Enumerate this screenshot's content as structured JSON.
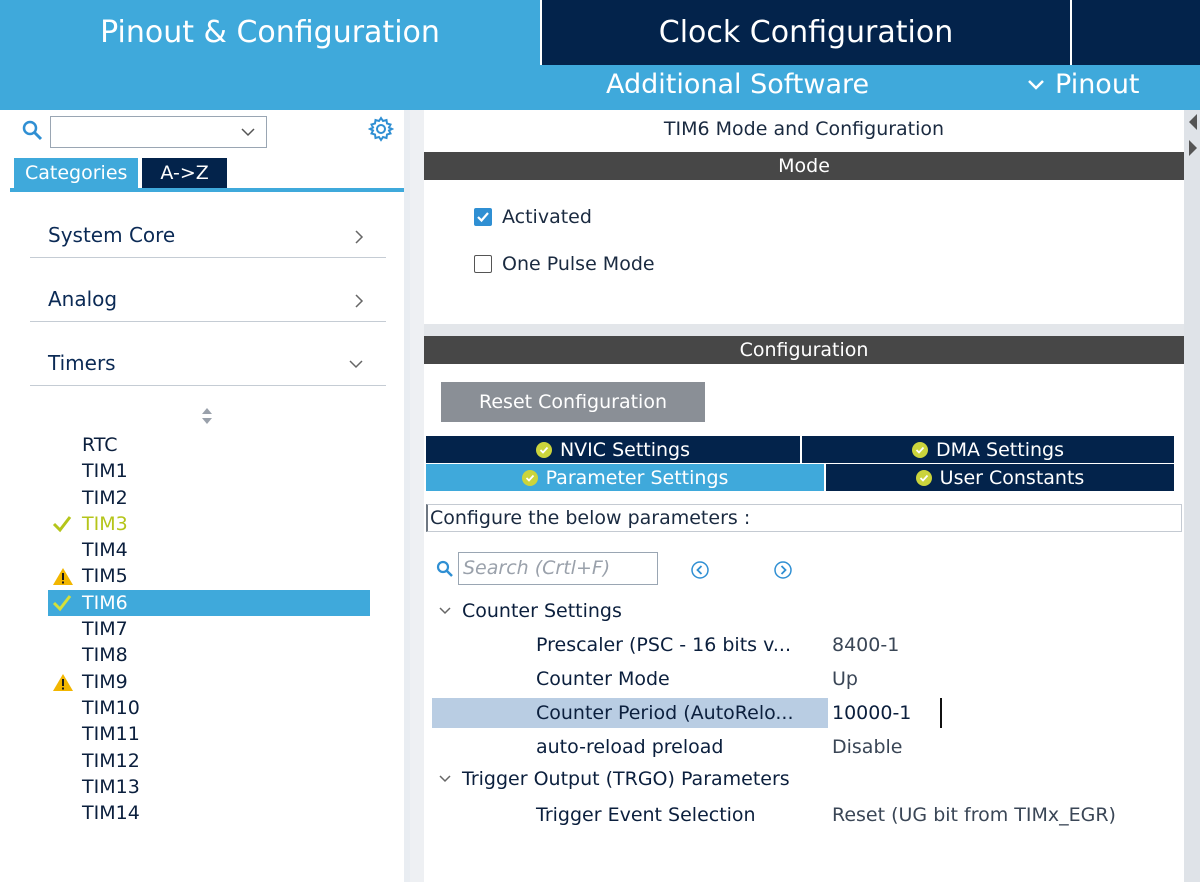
{
  "header": {
    "tab_pinout": "Pinout & Configuration",
    "tab_clock": "Clock Configuration",
    "additional_software": "Additional Software",
    "pinout_menu": "Pinout"
  },
  "sidebar": {
    "search_value": "",
    "tabs": {
      "categories": "Categories",
      "az": "A->Z"
    },
    "categories": [
      {
        "label": "System Core"
      },
      {
        "label": "Analog"
      },
      {
        "label": "Timers"
      }
    ],
    "timers": [
      {
        "label": "RTC",
        "status": "none"
      },
      {
        "label": "TIM1",
        "status": "none"
      },
      {
        "label": "TIM2",
        "status": "none"
      },
      {
        "label": "TIM3",
        "status": "ok"
      },
      {
        "label": "TIM4",
        "status": "none"
      },
      {
        "label": "TIM5",
        "status": "warning"
      },
      {
        "label": "TIM6",
        "status": "ok",
        "selected": true
      },
      {
        "label": "TIM7",
        "status": "none"
      },
      {
        "label": "TIM8",
        "status": "none"
      },
      {
        "label": "TIM9",
        "status": "warning"
      },
      {
        "label": "TIM10",
        "status": "none"
      },
      {
        "label": "TIM11",
        "status": "none"
      },
      {
        "label": "TIM12",
        "status": "none"
      },
      {
        "label": "TIM13",
        "status": "none"
      },
      {
        "label": "TIM14",
        "status": "none"
      }
    ]
  },
  "mode": {
    "title": "TIM6 Mode and Configuration",
    "section": "Mode",
    "activated_label": "Activated",
    "activated_checked": true,
    "one_pulse_label": "One Pulse Mode",
    "one_pulse_checked": false
  },
  "config": {
    "section": "Configuration",
    "reset_label": "Reset Configuration",
    "tabs": {
      "nvic": "NVIC Settings",
      "dma": "DMA Settings",
      "parameter": "Parameter Settings",
      "user_constants": "User Constants"
    },
    "instructions": "Configure the below parameters :",
    "search_placeholder": "Search (Crtl+F)",
    "groups": {
      "counter": "Counter Settings",
      "trigger": "Trigger Output (TRGO) Parameters"
    },
    "params": {
      "prescaler_key": "Prescaler (PSC - 16 bits v...",
      "prescaler_val": "8400-1",
      "counter_mode_key": "Counter Mode",
      "counter_mode_val": "Up",
      "counter_period_key": "Counter Period (AutoRelo...",
      "counter_period_val": "10000-1",
      "autoreload_key": "auto-reload preload",
      "autoreload_val": "Disable",
      "trigger_event_key": "Trigger Event Selection",
      "trigger_event_val": "Reset (UG bit from TIMx_EGR)"
    }
  },
  "colors": {
    "accent_blue": "#3fa9db",
    "navy": "#03234b",
    "ok_green": "#b5c51a",
    "warning_yellow": "#f2b600"
  }
}
